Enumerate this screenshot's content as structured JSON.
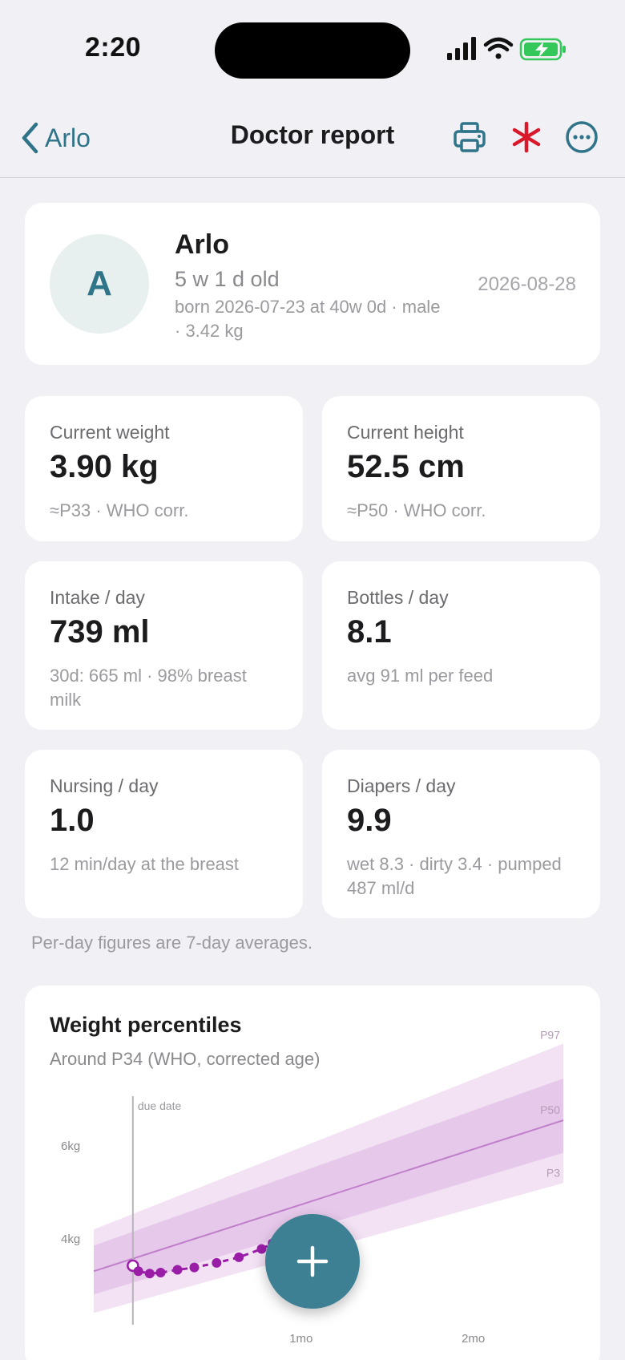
{
  "status_bar": {
    "time": "2:20",
    "icons": [
      "signal-icon",
      "wifi-icon",
      "battery-charging-icon"
    ],
    "battery_color": "#34c759"
  },
  "nav": {
    "back_label": "Arlo",
    "title": "Doctor report",
    "icons": [
      "printer-icon",
      "asterisk-icon",
      "more-icon"
    ],
    "accent_color": "#2f7488",
    "asterisk_color": "#d9192b"
  },
  "profile": {
    "initial": "A",
    "name": "Arlo",
    "age": "5 w 1 d old",
    "born": "born 2026-07-23 at 40w 0d · male · 3.42 kg",
    "report_date": "2026-08-28"
  },
  "stats": [
    {
      "label": "Current weight",
      "value": "3.90 kg",
      "note": "≈P33 · WHO corr."
    },
    {
      "label": "Current height",
      "value": "52.5 cm",
      "note": "≈P50 · WHO corr."
    },
    {
      "label": "Intake / day",
      "value": "739 ml",
      "note": "30d: 665 ml · 98% breast milk"
    },
    {
      "label": "Bottles / day",
      "value": "8.1",
      "note": "avg 91 ml per feed"
    },
    {
      "label": "Nursing / day",
      "value": "1.0",
      "note": "12 min/day at the breast"
    },
    {
      "label": "Diapers / day",
      "value": "9.9",
      "note": "wet 8.3 · dirty 3.4 · pumped 487 ml/d"
    }
  ],
  "footnote": "Per-day figures are 7-day averages.",
  "chart": {
    "title": "Weight percentiles",
    "subtitle": "Around P34 (WHO, corrected age)"
  },
  "chart_data": {
    "type": "line",
    "x_unit": "weeks (corrected age)",
    "y_unit": "kg",
    "xlim": [
      -1,
      11
    ],
    "ylim": [
      2.2,
      7.0
    ],
    "x_ticks": [
      {
        "x": 4.3,
        "label": "1mo"
      },
      {
        "x": 8.7,
        "label": "2mo"
      }
    ],
    "y_ticks": [
      {
        "y": 4,
        "label": "4kg"
      },
      {
        "y": 6,
        "label": "6kg"
      }
    ],
    "due_date_label": "due date",
    "due_date_x": 0,
    "bands": [
      {
        "name": "P97",
        "lower_name": "P3",
        "x": [
          -1,
          11
        ],
        "low": [
          2.4,
          5.2
        ],
        "high": [
          4.2,
          8.2
        ]
      },
      {
        "name": "P85-P15",
        "x": [
          -1,
          11
        ],
        "low": [
          2.8,
          5.85
        ],
        "high": [
          3.85,
          7.45
        ]
      }
    ],
    "series": [
      {
        "name": "P50",
        "x": [
          -1,
          11
        ],
        "y": [
          3.3,
          6.55
        ]
      },
      {
        "name": "weight",
        "x": [
          0,
          0.14,
          0.43,
          0.71,
          1.14,
          1.57,
          2.14,
          2.71,
          3.29,
          3.57
        ],
        "y": [
          3.42,
          3.3,
          3.25,
          3.27,
          3.33,
          3.38,
          3.48,
          3.6,
          3.78,
          3.9
        ]
      }
    ],
    "colors": {
      "band_outer": "#f3e1f4",
      "band_inner": "#e6c8ea",
      "median": "#c07ecb",
      "points": "#9a1da8",
      "due_line": "#b5b5b8"
    }
  }
}
